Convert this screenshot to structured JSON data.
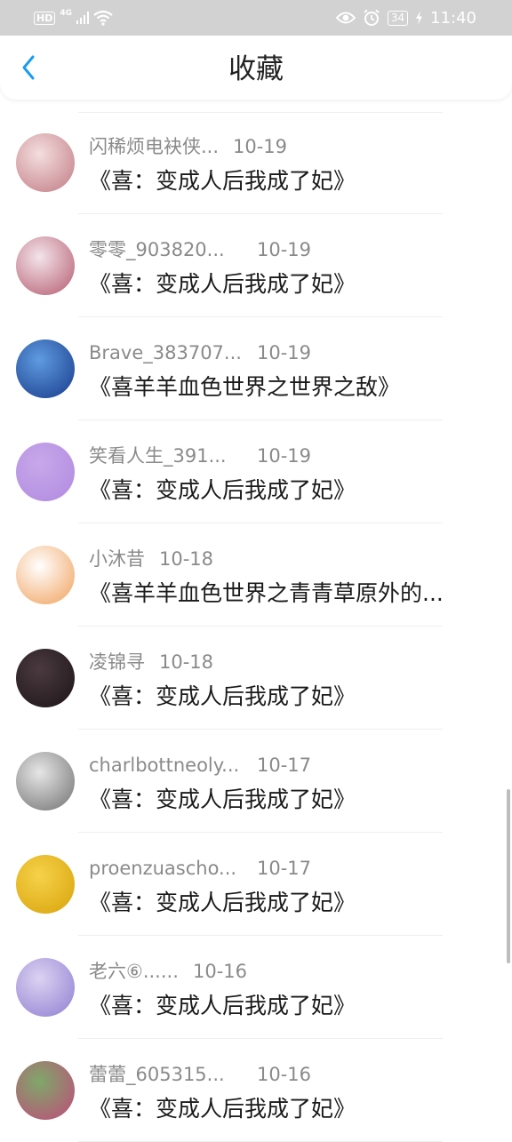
{
  "status_bar": {
    "hd": "HD",
    "network": "4G",
    "battery": "34",
    "time": "11:40"
  },
  "nav": {
    "title": "收藏",
    "back_icon": "chevron-left-icon",
    "accent": "#1a9cf0"
  },
  "items": [
    {
      "user": "闪稀烦电袂侠...",
      "date": "10-19",
      "title": "《喜：变成人后我成了妃》",
      "avatar_colors": [
        "#f4dede",
        "#c07a84"
      ]
    },
    {
      "user": "零零_903820...",
      "date": "10-19",
      "title": "《喜：变成人后我成了妃》",
      "avatar_colors": [
        "#f3e4ea",
        "#b45a6e"
      ]
    },
    {
      "user": "Brave_383707...",
      "date": "10-19",
      "title": "《喜羊羊血色世界之世界之敌》",
      "avatar_colors": [
        "#5f9be0",
        "#173a8a"
      ]
    },
    {
      "user": "笑看人生_391...",
      "date": "10-19",
      "title": "《喜：变成人后我成了妃》",
      "avatar_colors": [
        "#c8a8ea",
        "#b08ae0"
      ]
    },
    {
      "user": "小沐昔",
      "date": "10-18",
      "title": "《喜羊羊血色世界之青青草原外的...",
      "avatar_colors": [
        "#ffffff",
        "#f0a05a"
      ]
    },
    {
      "user": "凌锦寻",
      "date": "10-18",
      "title": "《喜：变成人后我成了妃》",
      "avatar_colors": [
        "#4a3a40",
        "#1c1416"
      ]
    },
    {
      "user": "charlbottneoly...",
      "date": "10-17",
      "title": "《喜：变成人后我成了妃》",
      "avatar_colors": [
        "#e6e6e6",
        "#707070"
      ]
    },
    {
      "user": "proenzuascho...",
      "date": "10-17",
      "title": "《喜：变成人后我成了妃》",
      "avatar_colors": [
        "#f6d24a",
        "#d8a20a"
      ]
    },
    {
      "user": "老六⑥......",
      "date": "10-16",
      "title": "《喜：变成人后我成了妃》",
      "avatar_colors": [
        "#dcd2f2",
        "#8e7ed0"
      ]
    },
    {
      "user": "蕾蕾_605315...",
      "date": "10-16",
      "title": "《喜：变成人后我成了妃》",
      "avatar_colors": [
        "#7fa86a",
        "#c04a7a"
      ]
    }
  ]
}
